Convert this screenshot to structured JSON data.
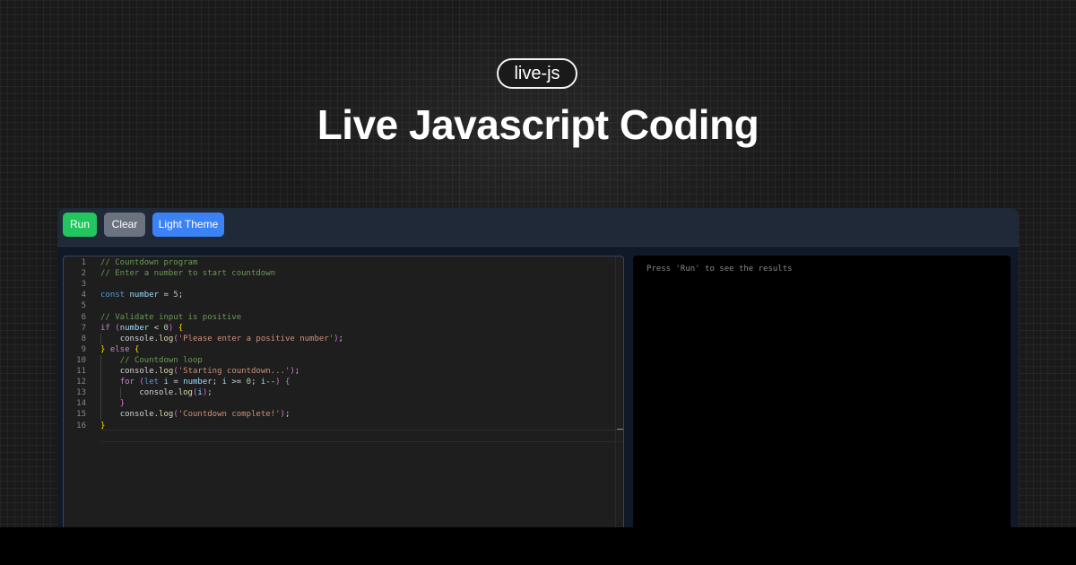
{
  "header": {
    "tag": "live-js",
    "title": "Live Javascript Coding"
  },
  "toolbar": {
    "run_label": "Run",
    "clear_label": "Clear",
    "theme_label": "Light Theme"
  },
  "editor": {
    "language": "javascript",
    "lines": [
      "// Countdown program",
      "// Enter a number to start countdown",
      "",
      "const number = 5;",
      "",
      "// Validate input is positive",
      "if (number < 0) {",
      "    console.log('Please enter a positive number');",
      "} else {",
      "    // Countdown loop",
      "    console.log('Starting countdown...');",
      "    for (let i = number; i >= 0; i--) {",
      "        console.log(i);",
      "    }",
      "    console.log('Countdown complete!');",
      "}"
    ]
  },
  "output": {
    "placeholder": "Press 'Run' to see the results"
  },
  "colors": {
    "run_button": "#22c55e",
    "clear_button": "#6b7280",
    "theme_button": "#3b82f6",
    "toolbar_bg": "#1f2937",
    "editor_bg": "#1e1e1e",
    "output_bg": "#000000"
  }
}
